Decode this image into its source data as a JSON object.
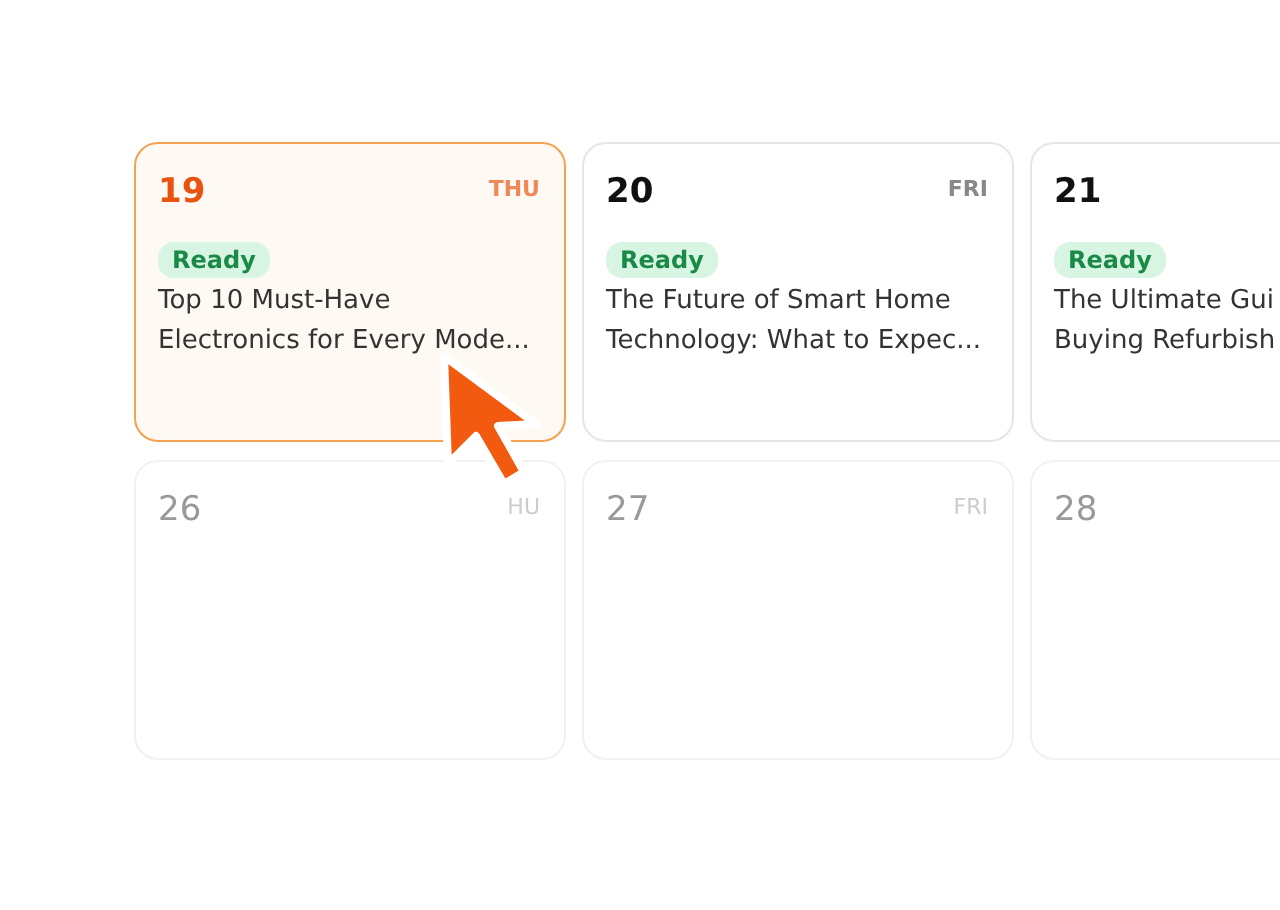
{
  "weeks": [
    {
      "days": [
        {
          "date": "19",
          "weekday": "THU",
          "selected": true,
          "dimmed": false,
          "status": "Ready",
          "title_lines": [
            "Top 10 Must-Have",
            "Electronics for Every Mode..."
          ]
        },
        {
          "date": "20",
          "weekday": "FRI",
          "selected": false,
          "dimmed": false,
          "status": "Ready",
          "title_lines": [
            "The Future of Smart Home",
            "Technology: What to Expec..."
          ]
        },
        {
          "date": "21",
          "selected": false,
          "dimmed": false,
          "status": "Ready",
          "title_lines": [
            "The Ultimate Gui",
            "Buying Refurbish"
          ]
        }
      ]
    },
    {
      "days": [
        {
          "date": "26",
          "weekday": "HU",
          "selected": false,
          "dimmed": true
        },
        {
          "date": "27",
          "weekday": "FRI",
          "selected": false,
          "dimmed": true
        },
        {
          "date": "28",
          "selected": false,
          "dimmed": true
        }
      ]
    }
  ]
}
